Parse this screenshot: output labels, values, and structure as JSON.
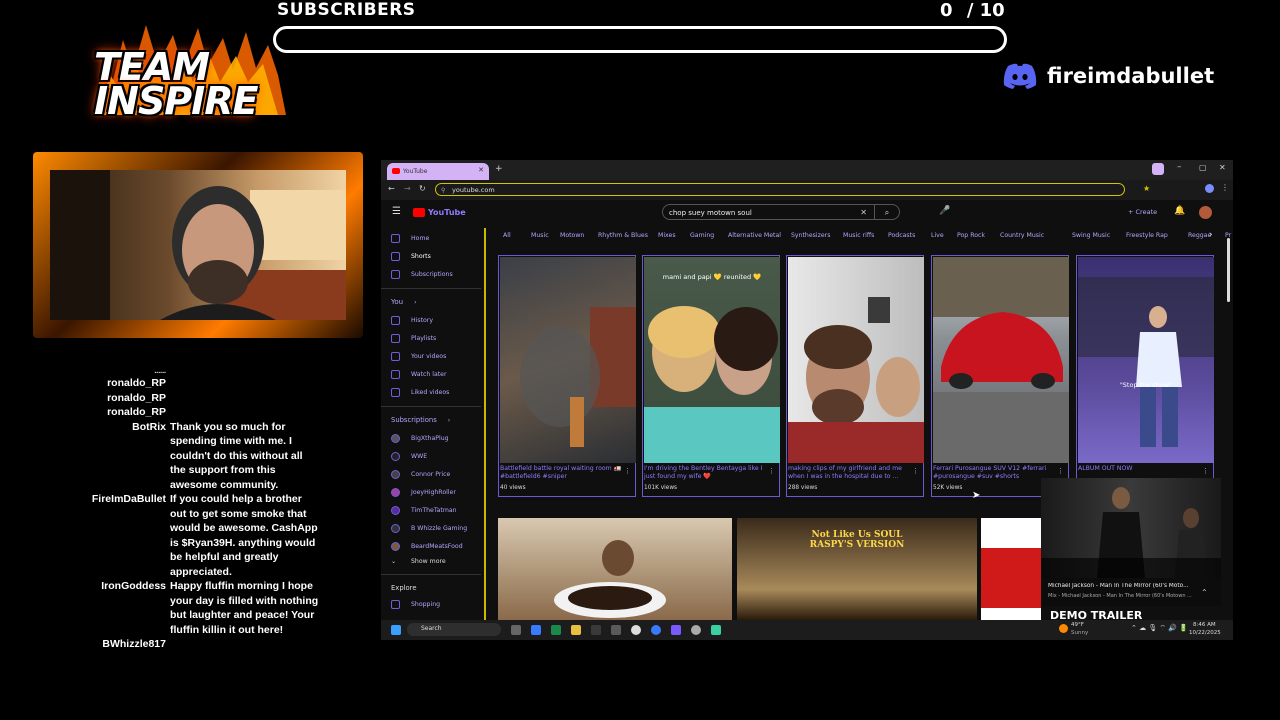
{
  "overlay": {
    "logo": {
      "line1": "TEAM",
      "line2": "INSPIRE"
    },
    "subscribers": {
      "label": "SUBSCRIBERS",
      "count": "0",
      "goal": "/ 10",
      "progress": 0
    },
    "discord": {
      "name": "fireimdabullet",
      "icon": "discord-icon",
      "color": "#5865F2"
    }
  },
  "chat": [
    {
      "user": "......",
      "msg": ""
    },
    {
      "user": "ronaldo_RP",
      "msg": ""
    },
    {
      "user": "ronaldo_RP",
      "msg": ""
    },
    {
      "user": "ronaldo_RP",
      "msg": ""
    },
    {
      "user": "BotRix",
      "msg": "Thank you so much for spending time with me. I couldn't do this without all the support from this awesome community."
    },
    {
      "user": "FireImDaBullet",
      "msg": "If you could help a brother out to get some smoke that would be awesome. CashApp is $Ryan39H. anything would be helpful and greatly appreciated."
    },
    {
      "user": "IronGoddess",
      "msg": "Happy fluffin morning I hope your day is filled with nothing but laughter and peace! Your fluffin killin it out here!"
    },
    {
      "user": "BWhizzle817",
      "msg": ""
    }
  ],
  "browser": {
    "tab_title": "YouTube",
    "url": "youtube.com",
    "yt_logo": "YouTube",
    "search_query": "chop suey motown soul",
    "create_label": "+ Create",
    "sidebar": {
      "main": [
        "Home",
        "Shorts",
        "Subscriptions"
      ],
      "you_header": "You",
      "you": [
        "History",
        "Playlists",
        "Your videos",
        "Watch later",
        "Liked videos"
      ],
      "subs_header": "Subscriptions",
      "subs": [
        "BigXthaPlug",
        "WWE",
        "Connor Price",
        "JoeyHighRoller",
        "TimTheTatman",
        "B Whizzle Gaming",
        "BeardMeatsFood"
      ],
      "show_more": "Show more",
      "explore_header": "Explore",
      "explore": [
        "Shopping"
      ]
    },
    "chips": [
      "All",
      "Music",
      "Motown",
      "Rhythm & Blues",
      "Mixes",
      "Gaming",
      "Alternative Metal",
      "Synthesizers",
      "Music riffs",
      "Podcasts",
      "Live",
      "Pop Rock",
      "Country Music",
      "Swing Music",
      "Freestyle Rap",
      "Reggae",
      "Pr"
    ],
    "shorts": [
      {
        "title": "Battlefield battle royal waiting room 🚛 #battlefield6 #sniper",
        "views": "40 views",
        "overlay": ""
      },
      {
        "title": "I'm driving the Bentley Bentayga like I just found my wife ❤️",
        "views": "101K views",
        "overlay": "mami and papi 💛 reunited 💛"
      },
      {
        "title": "making clips of my girlfriend and me when I was in the hospital due to ...",
        "views": "288 views",
        "overlay": ""
      },
      {
        "title": "Ferrari Purosangue SUV V12 #ferrari #purosangue #suv #shorts",
        "views": "52K views",
        "overlay": ""
      },
      {
        "title": "ALBUM OUT NOW",
        "views": "",
        "overlay": "\"Stop the show\""
      }
    ],
    "row2": [
      {
        "overlay": ""
      },
      {
        "overlay": "Not Like Us SOUL RASPY'S VERSION"
      },
      {
        "overlay": "DEMO TRAILER"
      }
    ],
    "miniplayer": {
      "title": "Michael Jackson - Man In The Mirror (60's Moto...",
      "subtitle": "Mix - Michael Jackson - Man In The Mirror (60's Motown ..."
    },
    "taskbar": {
      "search": "Search",
      "weather_temp": "49°F",
      "weather_desc": "Sunny",
      "time": "8:46 AM",
      "date": "10/22/2025"
    }
  }
}
